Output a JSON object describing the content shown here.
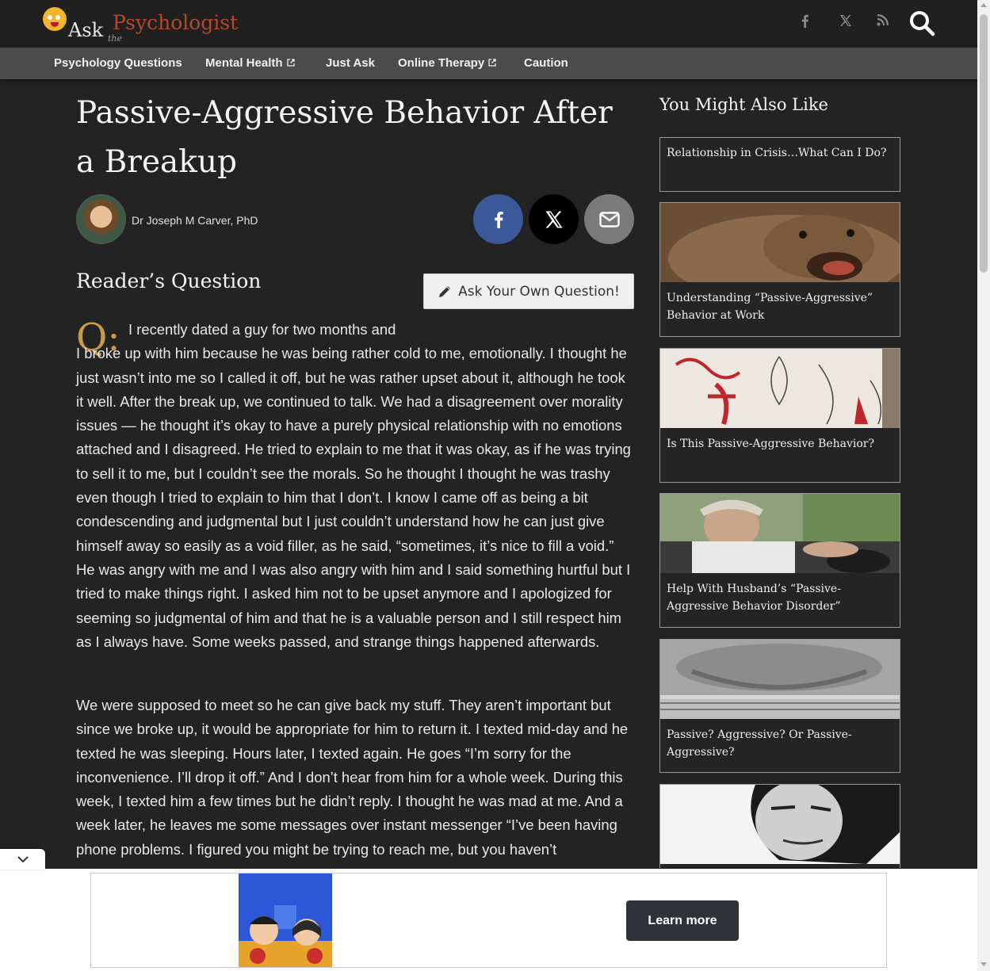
{
  "site": {
    "logo_ask": "Ask",
    "logo_the": "the",
    "logo_psychologist": "Psychologist"
  },
  "header_icons": [
    "facebook-icon",
    "x-icon",
    "rss-icon",
    "search-icon"
  ],
  "nav": {
    "items": [
      {
        "label": "Psychology Questions",
        "external": false
      },
      {
        "label": "Mental Health",
        "external": true
      },
      {
        "label": "Just Ask",
        "external": false
      },
      {
        "label": "Online Therapy",
        "external": true
      },
      {
        "label": "Caution",
        "external": false
      }
    ]
  },
  "article": {
    "title": "Passive-Aggressive Behavior After a Breakup",
    "author": "Dr Joseph M Carver, PhD",
    "section_heading": "Reader’s Question",
    "ask_button": "Ask Your Own Question!",
    "q_label": "Q:",
    "p1_first_line": "I recently dated a guy for two months and",
    "p1_rest": "I broke up with him because he was being rather cold to me, emotionally. I thought he just wasn’t into me so I called it off, but he was rather upset about it, although he took it well. After the break up, we continued to talk. We had a disagreement over morality issues — he thought it’s okay to have a purely physical relationship with no emotions attached and I disagreed. He tried to explain to me that it was okay, as if he was trying to sell it to me, but I couldn’t see the morals. So he thought I thought he was trashy even though I tried to explain to him that I don’t. I know I came off as being a bit condescending and judgmental but I just couldn’t understand how he can just give himself away so easily as a void filler, as he said, “sometimes, it’s nice to fill a void.” He was angry with me and I was also angry with him and I said something hurtful but I tried to make things right. I asked him not to be upset anymore and I apologized for seeming so judgmental of him and that he is a valuable person and I still respect him as I always have. Some weeks passed, and strange things happened afterwards.",
    "p2": "We were supposed to meet so he can give back my stuff. They aren’t important but since we broke up, it would be appropriate for him to return it. I texted mid-day and he texted he was sleeping. Hours later, I texted again. He goes “I’m sorry for the inconvenience. I’ll drop it off.” And I don’t hear from him for a whole week. During this week, I texted him a few times but he didn’t reply. I thought he was mad at me. And a week later, he leaves me some messages over instant messenger “I’ve been having phone problems. I figured you might be trying to reach me, but you haven’t"
  },
  "sidebar": {
    "heading": "You Might Also Like",
    "cards": [
      {
        "title": "Relationship in Crisis…What Can I Do?",
        "image": "none"
      },
      {
        "title": "Understanding “Passive-Aggressive” Behavior at Work",
        "image": "sea-lion"
      },
      {
        "title": "Is This Passive-Aggressive Behavior?",
        "image": "red-drawing"
      },
      {
        "title": "Help With Husband’s “Passive-Aggressive Behavior Disorder”",
        "image": "angry-driver"
      },
      {
        "title": "Passive? Aggressive? Or Passive-Aggressive?",
        "image": "crossed-arms"
      },
      {
        "title": "",
        "image": "man-face-bw"
      }
    ]
  },
  "ad": {
    "button": "Learn more"
  },
  "colors": {
    "background": "#232323",
    "navbar": "#4b4b4b",
    "logo_accent": "#b5482c",
    "q_mark": "#c99a4a",
    "facebook": "#3b5998"
  }
}
